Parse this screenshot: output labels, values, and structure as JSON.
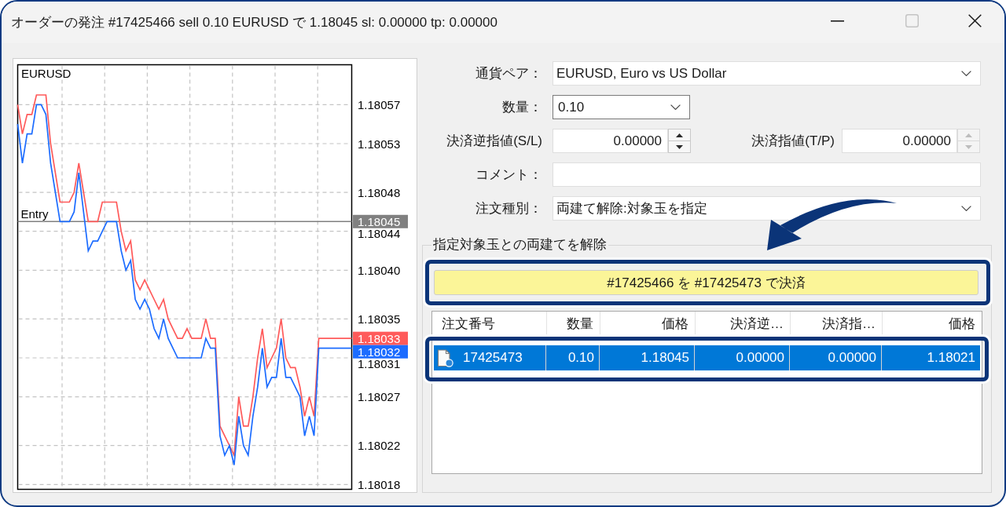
{
  "window": {
    "title": "オーダーの発注 #17425466 sell 0.10 EURUSD で 1.18045 sl: 0.00000 tp: 0.00000"
  },
  "title_bar_buttons": [
    {
      "kind": "minimize",
      "disabled": false
    },
    {
      "kind": "maximize",
      "disabled": true
    },
    {
      "kind": "close",
      "disabled": false
    }
  ],
  "chart": {
    "chart_data": {
      "type": "line",
      "title": "EURUSD",
      "series": [
        {
          "color": "#ff5a5a",
          "values": [
            1.18057,
            1.18054,
            1.18056,
            1.18056,
            1.18058,
            1.18058,
            1.18058,
            1.18053,
            1.1805,
            1.18047,
            1.18047,
            1.18047,
            1.18048,
            1.18051,
            1.18048,
            1.18045,
            1.18045,
            1.18045,
            1.18047,
            1.18047,
            1.18047,
            1.18047,
            1.18044,
            1.18042,
            1.18043,
            1.18039,
            1.18038,
            1.18039,
            1.18038,
            1.18037,
            1.18036,
            1.18037,
            1.18035,
            1.18034,
            1.18033,
            1.18033,
            1.18034,
            1.18033,
            1.18033,
            1.18033,
            1.18035,
            1.18033,
            1.18033,
            1.18024,
            1.18023,
            1.18022,
            1.18021,
            1.18027,
            1.18024,
            1.18024,
            1.18027,
            1.18031,
            1.18034,
            1.1803,
            1.18031,
            1.18032,
            1.18035,
            1.18031,
            1.1803,
            1.1803,
            1.18028,
            1.18025,
            1.18027,
            1.18025,
            1.18033,
            1.18033,
            1.18033,
            1.18033,
            1.18033,
            1.18033,
            1.18033,
            1.18033
          ]
        },
        {
          "color": "#1c6cff",
          "values": [
            1.18055,
            1.18051,
            1.18054,
            1.18054,
            1.18057,
            1.18057,
            1.18056,
            1.18051,
            1.18048,
            1.18045,
            1.18045,
            1.18045,
            1.18046,
            1.1805,
            1.18046,
            1.18042,
            1.18043,
            1.18043,
            1.18044,
            1.18045,
            1.18045,
            1.18045,
            1.18042,
            1.1804,
            1.18041,
            1.18037,
            1.18036,
            1.18037,
            1.18036,
            1.18034,
            1.18033,
            1.18035,
            1.18033,
            1.18032,
            1.18031,
            1.18031,
            1.18031,
            1.18031,
            1.18031,
            1.18031,
            1.18033,
            1.18032,
            1.18032,
            1.18023,
            1.18021,
            1.18022,
            1.1802,
            1.18025,
            1.18022,
            1.18021,
            1.18025,
            1.18028,
            1.18032,
            1.18028,
            1.18029,
            1.18029,
            1.18033,
            1.18029,
            1.18029,
            1.18028,
            1.18027,
            1.18023,
            1.18025,
            1.18023,
            1.18032,
            1.18032,
            1.18032,
            1.18032,
            1.18032,
            1.18032,
            1.18032,
            1.18032
          ]
        }
      ],
      "ylim": [
        1.180175,
        1.180611
      ],
      "yticks": [
        1.18057,
        1.18053,
        1.18048,
        1.18044,
        {
          "value": 1.1804,
          "label": "1.18040"
        },
        1.18035,
        1.18031,
        1.18027,
        1.18022,
        1.18018
      ],
      "grid": true,
      "ref_lines": [
        {
          "axis": "y",
          "value": 1.18045,
          "label": "Entry",
          "color": "#808080"
        }
      ],
      "annotations": [
        "1.18045",
        "1.18033",
        "1.18032"
      ]
    }
  },
  "form": {
    "symbol": {
      "label": "通貨ペア：",
      "value": "EURUSD, Euro vs US Dollar"
    },
    "volume": {
      "label": "数量：",
      "value": "0.10"
    },
    "stop_loss": {
      "label": "決済逆指値(S/L)",
      "value": "0.00000",
      "stepper_disabled": false
    },
    "take_profit": {
      "label": "決済指値(T/P)",
      "value": "0.00000",
      "stepper_disabled": true
    },
    "comment": {
      "label": "コメント："
    },
    "order_type": {
      "label": "注文種別：",
      "value": "両建て解除:対象玉を指定"
    }
  },
  "close_by": {
    "legend": "指定対象玉との両建てを解除",
    "button": "#17425466 を #17425473 で決済",
    "columns": [
      "注文番号",
      "数量",
      "価格",
      "決済逆…",
      "決済指…",
      "価格"
    ],
    "rows": [
      {
        "selected": true,
        "cells": [
          "17425473",
          "0.10",
          "1.18045",
          "0.00000",
          "0.00000",
          "1.18021"
        ]
      }
    ]
  }
}
